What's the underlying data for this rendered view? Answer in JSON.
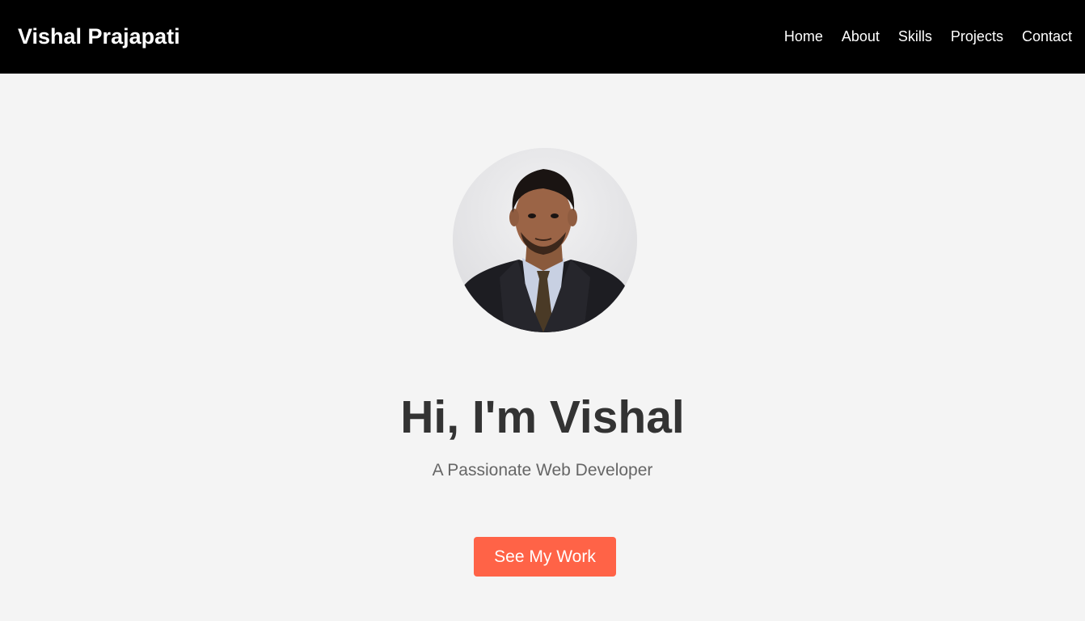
{
  "header": {
    "brand": "Vishal Prajapati",
    "nav": [
      "Home",
      "About",
      "Skills",
      "Projects",
      "Contact"
    ]
  },
  "hero": {
    "avatar_icon": "profile-photo",
    "title": "Hi, I'm Vishal",
    "subtitle": "A Passionate Web Developer",
    "cta_label": "See My Work"
  },
  "colors": {
    "navbar_bg": "#000000",
    "page_bg": "#f4f4f4",
    "title": "#333333",
    "subtitle": "#666666",
    "accent": "#ff6347"
  }
}
